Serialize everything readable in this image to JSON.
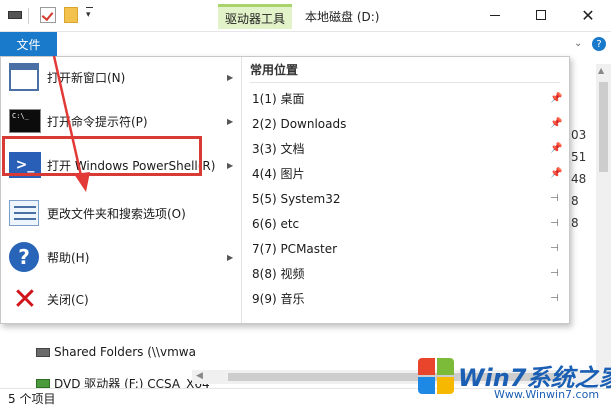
{
  "window": {
    "context_tab": "驱动器工具",
    "title": "本地磁盘 (D:)",
    "close_glyph": "✕"
  },
  "ribbon": {
    "file_tab": "文件",
    "expand_glyph": "⌄",
    "help_glyph": "?"
  },
  "file_menu": {
    "items": [
      {
        "label": "打开新窗口(N)",
        "has_submenu": true
      },
      {
        "label": "打开命令提示符(P)",
        "has_submenu": true
      },
      {
        "label": "打开 Windows PowerShell(R)",
        "has_submenu": true
      },
      {
        "label": "更改文件夹和搜索选项(O)",
        "has_submenu": false,
        "highlighted": true
      },
      {
        "label": "帮助(H)",
        "has_submenu": true
      },
      {
        "label": "关闭(C)",
        "has_submenu": false
      }
    ],
    "cmd_icon_text": "C:\\_",
    "ps_icon_text": ">_",
    "help_icon_text": "?",
    "close_icon_text": "✕",
    "submenu_arrow": "▶",
    "recent": {
      "header": "常用位置",
      "pinned_glyph": "📌",
      "unpinned_glyph": "⊣",
      "items": [
        {
          "label": "1(1) 桌面",
          "pinned": true
        },
        {
          "label": "2(2) Downloads",
          "pinned": true
        },
        {
          "label": "3(3) 文档",
          "pinned": true
        },
        {
          "label": "4(4) 图片",
          "pinned": true
        },
        {
          "label": "5(5) System32",
          "pinned": false
        },
        {
          "label": "6(6) etc",
          "pinned": false
        },
        {
          "label": "7(7) PCMaster",
          "pinned": false
        },
        {
          "label": "8(8) 视频",
          "pinned": false
        },
        {
          "label": "9(9) 音乐",
          "pinned": false
        }
      ]
    }
  },
  "background": {
    "right_numbers": [
      "03",
      "51",
      "48",
      "8",
      "8"
    ],
    "tree": [
      {
        "label": "Shared Folders (\\\\vmwa",
        "icon": "network-drive-icon"
      },
      {
        "label": "DVD 驱动器 (F:) CCSA_X64",
        "icon": "dvd-drive-icon"
      }
    ]
  },
  "status": {
    "item_count": "5 个项目"
  },
  "watermark": {
    "brand": "Win7系统之家",
    "url": "Www.Winwin7.com"
  },
  "colors": {
    "file_tab_bg": "#1979ca",
    "context_tab_bg": "#e2f2c9",
    "highlight_border": "#d83b36",
    "annotation_arrow": "#e23a36"
  }
}
